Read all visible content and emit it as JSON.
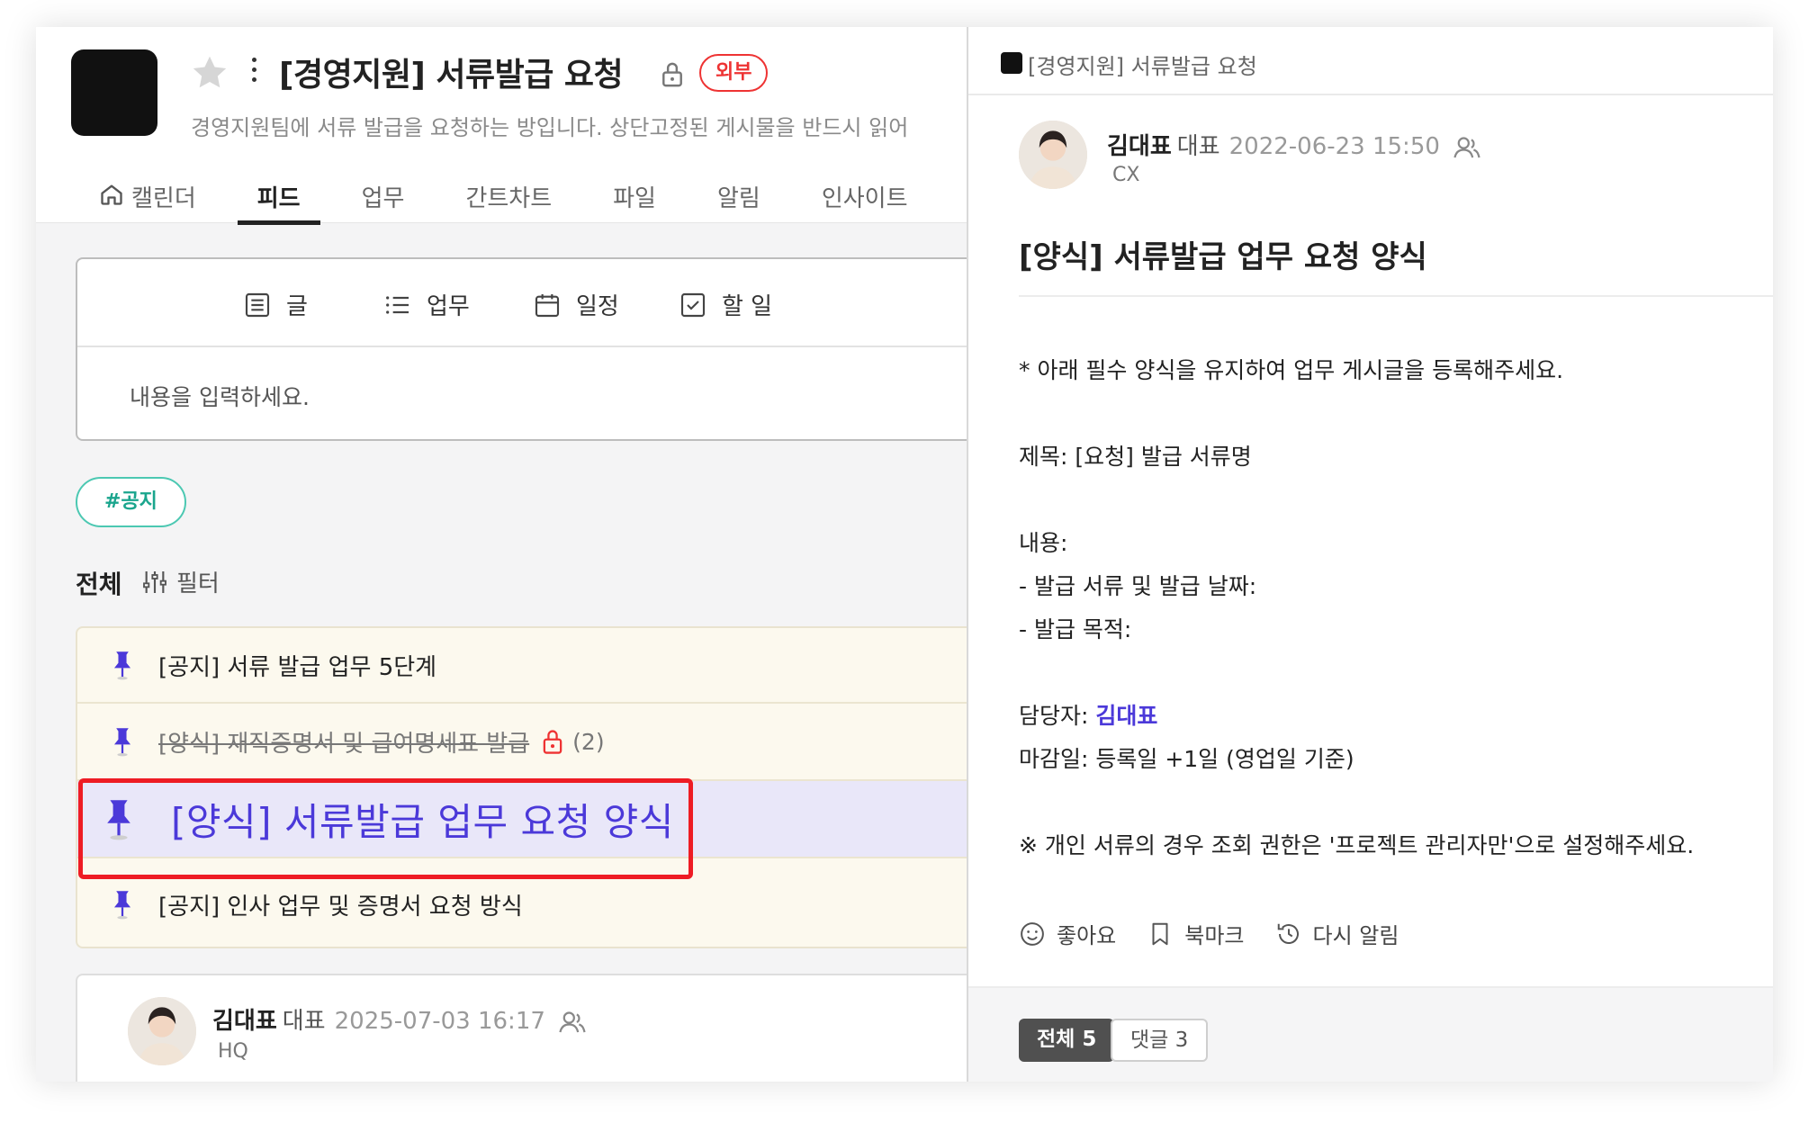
{
  "project": {
    "title": "[경영지원] 서류발급 요청",
    "badge": "외부",
    "description": "경영지원팀에 서류 발급을 요청하는 방입니다. 상단고정된 게시물을 반드시 읽어"
  },
  "tabs": [
    {
      "label": "캘린더",
      "icon": "home-icon"
    },
    {
      "label": "피드",
      "active": true
    },
    {
      "label": "업무"
    },
    {
      "label": "간트차트"
    },
    {
      "label": "파일"
    },
    {
      "label": "알림"
    },
    {
      "label": "인사이트"
    }
  ],
  "composer": {
    "types": [
      "글",
      "업무",
      "일정",
      "할 일"
    ],
    "placeholder": "내용을 입력하세요."
  },
  "hashtag": "#공지",
  "feed": {
    "all_label": "전체",
    "filter_label": "필터"
  },
  "pinned": [
    {
      "text": "[공지] 서류 발급 업무 5단계"
    },
    {
      "text": "[양식] 재직증명서 및 급여명세표 발급",
      "strikethrough": true,
      "locked": true,
      "count": "(2)"
    },
    {
      "text": "[양식] 서류발급 업무 요청 양식",
      "selected": true
    },
    {
      "text": "[공지] 인사 업무 및 증명서 요청 방식"
    }
  ],
  "bottom_post": {
    "author": "김대표",
    "role": "대표",
    "date": "2025-07-03 16:17",
    "team": "HQ"
  },
  "detail": {
    "breadcrumb": "[경영지원] 서류발급 요청",
    "author": "김대표",
    "role": "대표",
    "date": "2022-06-23 15:50",
    "team": "CX",
    "title": "[양식] 서류발급 업무 요청 양식",
    "lines": [
      "* 아래 필수 양식을 유지하여 업무 게시글을 등록해주세요.",
      "제목:  [요청] 발급 서류명",
      "내용:",
      "- 발급 서류 및 발급 날짜:",
      "- 발급 목적:",
      "담당자: ",
      "마감일: 등록일 +1일 (영업일 기준)",
      "※ 개인 서류의 경우 조회 권한은 '프로젝트 관리자만'으로 설정해주세요."
    ],
    "assignee_mention": "김대표",
    "actions": [
      "좋아요",
      "북마크",
      "다시 알림"
    ],
    "footer_tabs": [
      "전체 5",
      "댓글 3"
    ]
  },
  "colors": {
    "accent": "#4b39d9",
    "highlight_border": "#ee1c24",
    "badge_red": "#ee3333",
    "hashtag_teal": "#1aa58d",
    "pinned_bg": "#fcf9ee"
  }
}
